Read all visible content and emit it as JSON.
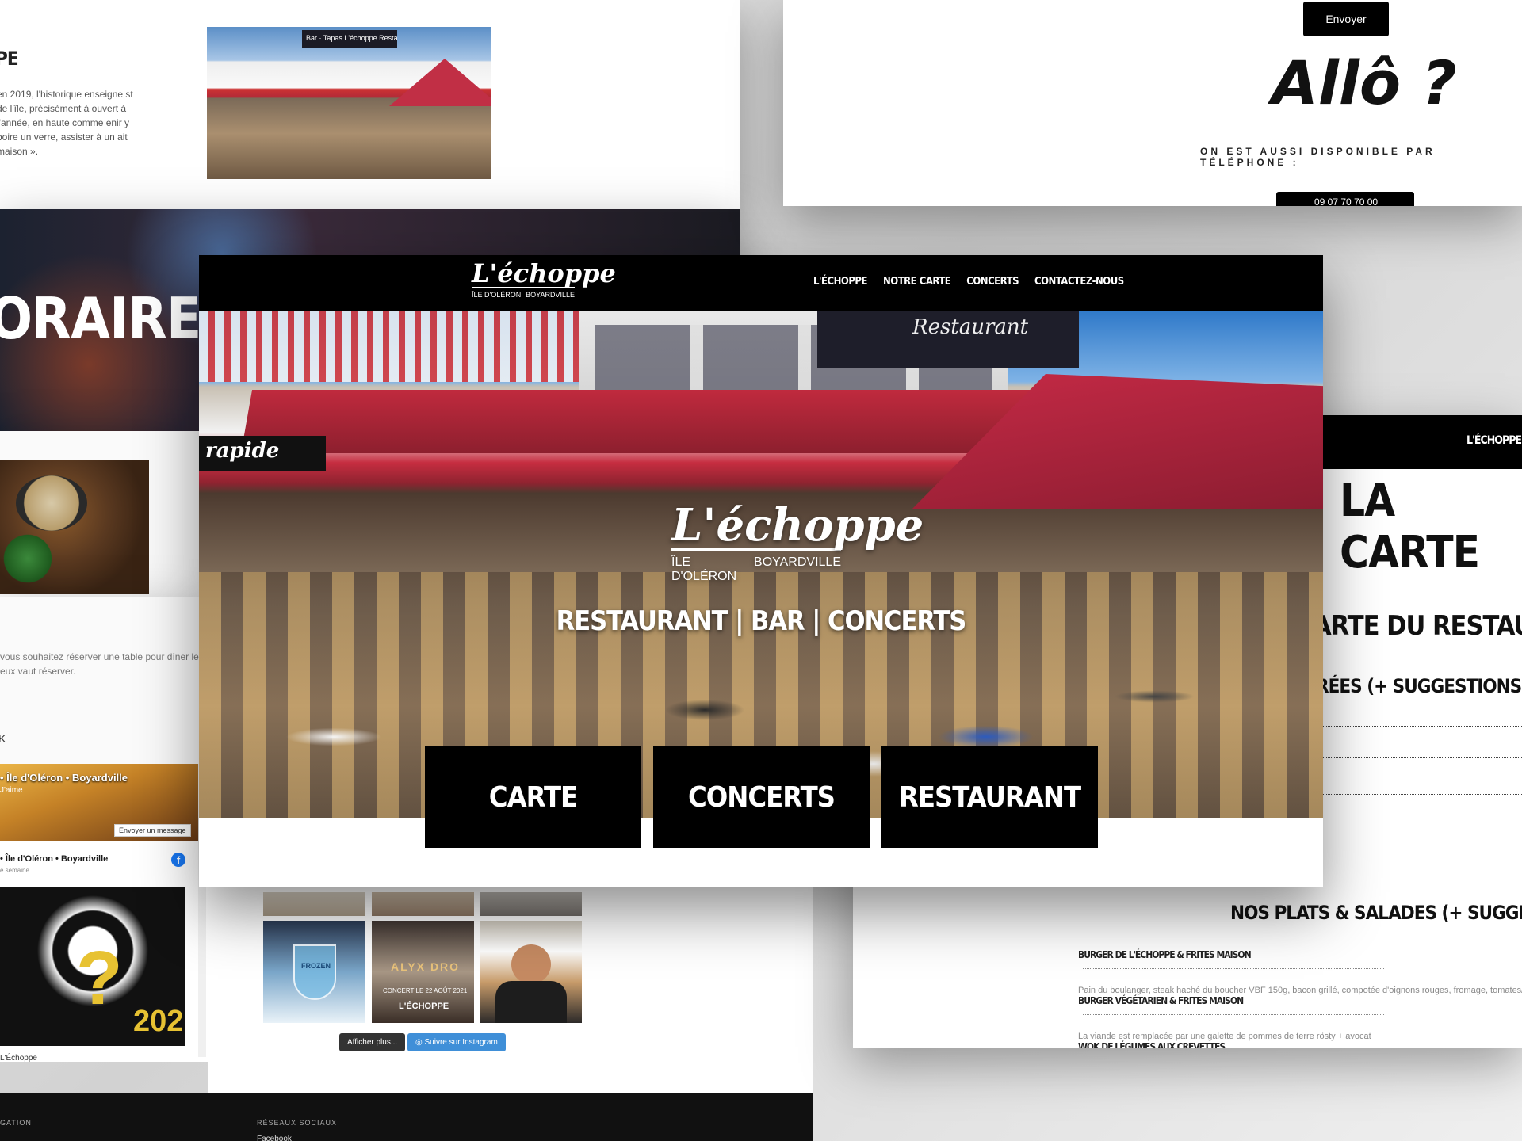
{
  "about": {
    "title": "PE",
    "text": "en 2019, l'historique enseigne st de l'île, précisément à ouvert à l'année, en haute comme enir y boire un verre, assister à un ait maison »."
  },
  "horaires": {
    "title": "ORAIRES :"
  },
  "reserve": {
    "text": "vous souhaitez réserver une table pour dîner les eux vaut réserver.",
    "k": "K"
  },
  "facebook": {
    "page_name": "• Île d'Oléron • Boyardville",
    "like": "J'aime",
    "send_message": "Envoyer un message",
    "post_name": "• Île d'Oléron • Boyardville",
    "post_time": "e semaine",
    "icon": "facebook-icon",
    "post_image_text": "?",
    "post_image_year": "202",
    "footer_name": "L'Échoppe"
  },
  "instagram": {
    "tile1_text": "FROZEN",
    "tile2_title": "ALYX DRO",
    "tile2_sub": "CONCERT LE 22 AOÛT 2021",
    "tile2_brand": "L'ÉCHOPPE",
    "more_label": "Afficher plus...",
    "follow_label": "Suivre sur Instagram",
    "follow_icon": "instagram-icon"
  },
  "footer": {
    "nav_heading": "GATION",
    "social_heading": "RÉSEAUX SOCIAUX",
    "social_link": "Facebook"
  },
  "contact": {
    "send_label": "Envoyer",
    "allo": "Allô ?",
    "subtitle": "ON EST AUSSI DISPONIBLE PAR TÉLÉPHONE :",
    "phone_icon": "phone-icon",
    "phone": "09 07 70 70 00"
  },
  "carte": {
    "nav_item": "L'ÉCHOPPE",
    "title": "LA CARTE",
    "subtitle": "ARTE DU RESTAURANT",
    "entrees": "RÉES (+ SUGGESTIONS À L'ARI",
    "plats": "NOS PLATS & SALADES (+ SUGGESTIONS À",
    "items": [
      {
        "name": "BURGER DE L'ÉCHOPPE & FRITES MAISON",
        "desc": "Pain du boulanger, steak haché du boucher VBF 150g, bacon grillé, compotée d'oignons rouges, fromage, tomates/salade"
      },
      {
        "name": "BURGER VÉGÉTARIEN & FRITES MAISON",
        "desc": "La viande est remplacée par une galette de pommes de terre rösty + avocat"
      },
      {
        "name": "WOK DE LÉGUMES AUX CREVETTES",
        "desc": ""
      }
    ]
  },
  "hero": {
    "logo": "L'échoppe",
    "logo_left": "ÎLE D'OLÉRON",
    "logo_right": "BOYARDVILLE",
    "nav": [
      "L'ÉCHOPPE",
      "NOTRE CARTE",
      "CONCERTS",
      "CONTACTEZ-NOUS"
    ],
    "sign_rapide": "rapide",
    "sign_restaurant": "Restaurant",
    "tagline": "RESTAURANT | BAR | CONCERTS",
    "cta": [
      "CARTE",
      "CONCERTS",
      "RESTAURANT"
    ]
  },
  "about_photo_sign": "Bar · Tapas  L'échoppe  Restaurant"
}
